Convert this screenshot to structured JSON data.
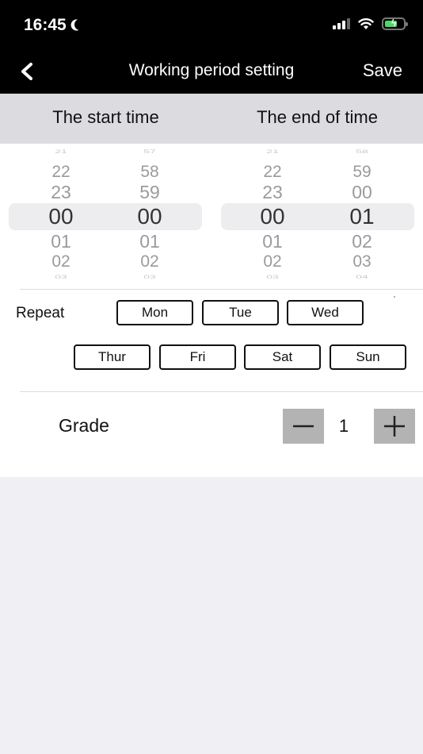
{
  "status_bar": {
    "time": "16:45"
  },
  "nav": {
    "title": "Working period setting",
    "save_label": "Save"
  },
  "header": {
    "start_label": "The start time",
    "end_label": "The end of time"
  },
  "start_picker": {
    "hours": {
      "items": [
        "21",
        "22",
        "23",
        "00",
        "01",
        "02",
        "03"
      ],
      "selected": "00"
    },
    "minutes": {
      "items": [
        "57",
        "58",
        "59",
        "00",
        "01",
        "02",
        "03"
      ],
      "selected": "00"
    }
  },
  "end_picker": {
    "hours": {
      "items": [
        "21",
        "22",
        "23",
        "00",
        "01",
        "02",
        "03"
      ],
      "selected": "00"
    },
    "minutes": {
      "items": [
        "58",
        "59",
        "00",
        "01",
        "02",
        "03",
        "04"
      ],
      "selected": "01"
    }
  },
  "repeat": {
    "label": "Repeat",
    "days": [
      "Mon",
      "Tue",
      "Wed",
      "Thur",
      "Fri",
      "Sat",
      "Sun"
    ]
  },
  "grade": {
    "label": "Grade",
    "value": "1"
  }
}
